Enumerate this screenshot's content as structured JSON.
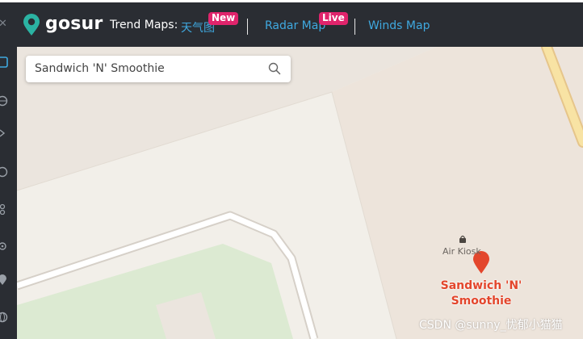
{
  "header": {
    "brand": "gosur",
    "trend_label": "Trend Maps:",
    "links": [
      {
        "label": "天气图",
        "badge": "New"
      },
      {
        "label": "Radar Map",
        "badge": "Live"
      },
      {
        "label": "Winds Map",
        "badge": ""
      }
    ]
  },
  "search": {
    "value": "Sandwich 'N' Smoothie"
  },
  "map": {
    "poi_label": "Air Kiosk",
    "place_title_line1": "Sandwich 'N'",
    "place_title_line2": "Smoothie"
  },
  "watermark": "CSDN @sunny_忧郁小猫猫",
  "colors": {
    "header_bg": "#2a2d33",
    "link": "#3fa9e0",
    "badge": "#e0246c",
    "brand_accent": "#2bb3a3",
    "marker": "#e3462c"
  }
}
